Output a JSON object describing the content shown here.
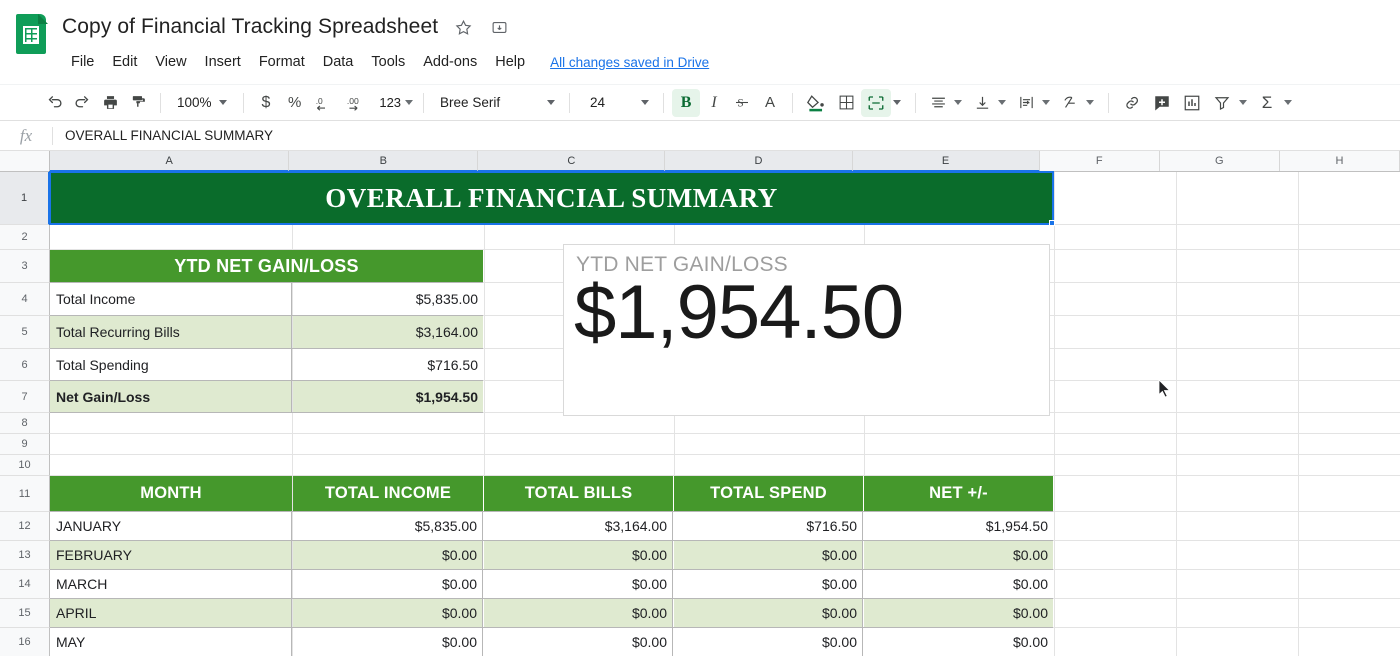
{
  "app": {
    "logo_icon": "sheets-logo-icon",
    "doc_title": "Copy of Financial Tracking Spreadsheet",
    "star_icon": "★",
    "move_icon": "⊡",
    "save_state": "All changes saved in Drive"
  },
  "menus": [
    "File",
    "Edit",
    "View",
    "Insert",
    "Format",
    "Data",
    "Tools",
    "Add-ons",
    "Help"
  ],
  "toolbar": {
    "undo": "undo-icon",
    "redo": "redo-icon",
    "print": "print-icon",
    "paint": "paint-format-icon",
    "zoom_value": "100%",
    "currency": "$",
    "percent": "%",
    "dec_decrease": ".0",
    "dec_increase": ".00",
    "number_format": "123",
    "font_value": "Bree Serif",
    "size_value": "24",
    "bold": "B",
    "italic": "I",
    "strikethrough": "S",
    "text_color": "A",
    "fill_color": "fill-color-icon",
    "borders": "borders-icon",
    "merge_cells": "merge-cells-icon",
    "h_align": "horizontal-align-icon",
    "v_align": "vertical-align-icon",
    "text_wrap": "text-wrapping-icon",
    "text_rotation": "text-rotation-icon",
    "insert_link": "link-icon",
    "insert_comment": "comment-icon",
    "insert_chart": "chart-icon",
    "filter": "filter-icon",
    "functions": "Σ"
  },
  "formula_bar": {
    "fx": "fx",
    "value": "OVERALL FINANCIAL SUMMARY"
  },
  "grid": {
    "columns": [
      "A",
      "B",
      "C",
      "D",
      "E",
      "F",
      "G",
      "H"
    ],
    "selected_columns": [
      "A",
      "B",
      "C",
      "D",
      "E"
    ],
    "rows": [
      "1",
      "2",
      "3",
      "4",
      "5",
      "6",
      "7",
      "8",
      "9",
      "10",
      "11",
      "12",
      "13",
      "14",
      "15",
      "16"
    ],
    "selected_rows": [
      "1"
    ]
  },
  "sheet": {
    "banner_title": "OVERALL FINANCIAL SUMMARY",
    "ytd_table": {
      "header": "YTD NET GAIN/LOSS",
      "rows": [
        {
          "label": "Total Income",
          "value": "$5,835.00",
          "bold": false,
          "band": false
        },
        {
          "label": "Total Recurring Bills",
          "value": "$3,164.00",
          "bold": false,
          "band": true
        },
        {
          "label": "Total Spending",
          "value": "$716.50",
          "bold": false,
          "band": false
        },
        {
          "label": "Net Gain/Loss",
          "value": "$1,954.50",
          "bold": true,
          "band": true
        }
      ]
    },
    "monthly_table": {
      "headers": [
        "MONTH",
        "TOTAL INCOME",
        "TOTAL BILLS",
        "TOTAL SPEND",
        "NET +/-"
      ],
      "rows": [
        {
          "month": "JANUARY",
          "income": "$5,835.00",
          "bills": "$3,164.00",
          "spend": "$716.50",
          "net": "$1,954.50",
          "band": false
        },
        {
          "month": "FEBRUARY",
          "income": "$0.00",
          "bills": "$0.00",
          "spend": "$0.00",
          "net": "$0.00",
          "band": true
        },
        {
          "month": "MARCH",
          "income": "$0.00",
          "bills": "$0.00",
          "spend": "$0.00",
          "net": "$0.00",
          "band": false
        },
        {
          "month": "APRIL",
          "income": "$0.00",
          "bills": "$0.00",
          "spend": "$0.00",
          "net": "$0.00",
          "band": true
        },
        {
          "month": "MAY",
          "income": "$0.00",
          "bills": "$0.00",
          "spend": "$0.00",
          "net": "$0.00",
          "band": false
        }
      ]
    }
  },
  "chart_data": {
    "type": "table",
    "title": "YTD NET GAIN/LOSS",
    "value": "$1,954.50",
    "categories": [
      "Total Income",
      "Total Recurring Bills",
      "Total Spending",
      "Net Gain/Loss"
    ],
    "values": [
      5835.0,
      3164.0,
      716.5,
      1954.5
    ],
    "monthly_categories": [
      "JANUARY",
      "FEBRUARY",
      "MARCH",
      "APRIL",
      "MAY"
    ],
    "series": [
      {
        "name": "TOTAL INCOME",
        "values": [
          5835.0,
          0,
          0,
          0,
          0
        ]
      },
      {
        "name": "TOTAL BILLS",
        "values": [
          3164.0,
          0,
          0,
          0,
          0
        ]
      },
      {
        "name": "TOTAL SPEND",
        "values": [
          716.5,
          0,
          0,
          0,
          0
        ]
      },
      {
        "name": "NET +/-",
        "values": [
          1954.5,
          0,
          0,
          0,
          0
        ]
      }
    ],
    "xlabel": "",
    "ylabel": ""
  },
  "colors": {
    "banner_green": "#0a6c2b",
    "header_green": "#45982c",
    "band_green": "#dfead0",
    "selection_blue": "#1a73e8",
    "link_blue": "#1a73e8"
  }
}
